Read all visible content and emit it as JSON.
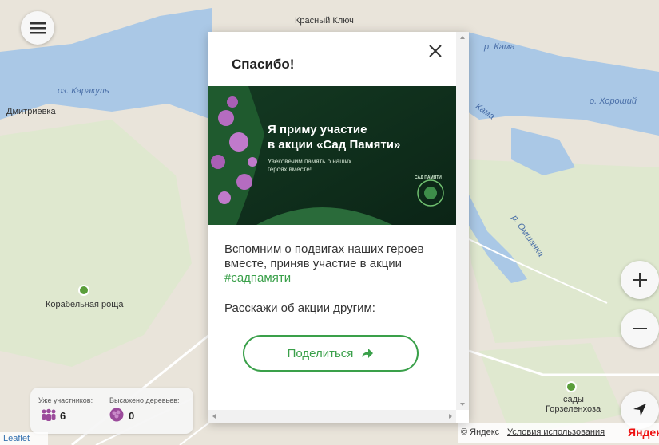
{
  "map": {
    "labels": {
      "top": "Красный Ключ",
      "karakul": "оз. Каракуль",
      "dmitrievka": "Дмитриевка",
      "kama_top": "р. Кама",
      "khoroshiy": "о. Хороший",
      "kama_mid": "Кама",
      "omshanka": "р. Омшанка",
      "korabelnaya": "Корабельная роща",
      "sady": "сады",
      "gorzelenkhoza": "Горзеленхоза"
    },
    "leaflet": "Leaflet",
    "attribution": "© Яндекс",
    "terms": "Условия использования",
    "yandex": "Яндекс"
  },
  "stats": {
    "participants_label": "Уже участников:",
    "participants_value": "6",
    "trees_label": "Высажено деревьев:",
    "trees_value": "0"
  },
  "modal": {
    "title": "Спасибо!",
    "banner": {
      "headline_1": "Я приму участие",
      "headline_2": "в акции «Сад Памяти»",
      "sub_1": "Увековечим память о наших",
      "sub_2": "героях вместе!",
      "logo_text": "САД ПАМЯТИ"
    },
    "desc_main": "Вспомним о подвигах наших героев вместе, приняв участие в акции ",
    "hashtag": "#садпамяти",
    "share_prompt": "Расскажи об акции другим:",
    "share_button": "Поделиться"
  },
  "colors": {
    "accent": "#3aa04a",
    "river": "#aac8e6"
  }
}
